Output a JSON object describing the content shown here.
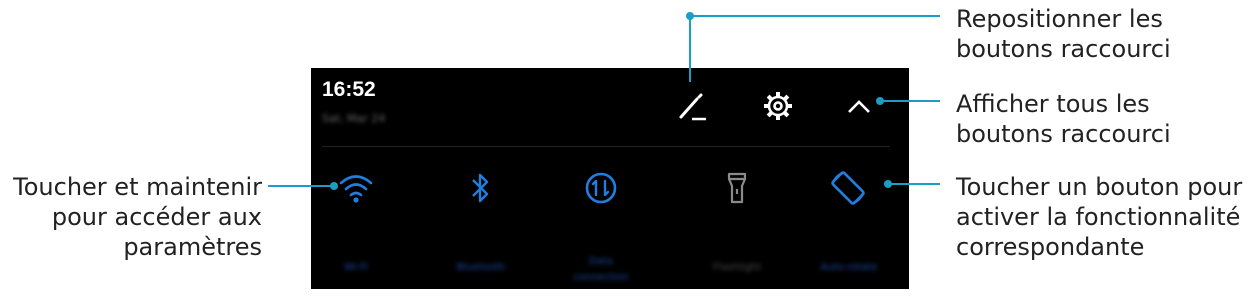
{
  "status": {
    "time": "16:52",
    "date": "Sat, Mar 24"
  },
  "toolbar": {
    "edit_icon": "pencil-edit-icon",
    "settings_icon": "gear-icon",
    "collapse_icon": "chevron-up-icon"
  },
  "tiles": [
    {
      "name": "wifi",
      "label": "Wi-Fi",
      "icon": "wifi-icon",
      "active": true
    },
    {
      "name": "bluetooth",
      "label": "Bluetooth",
      "icon": "bluetooth-icon",
      "active": true
    },
    {
      "name": "data",
      "label_line1": "Data",
      "label_line2": "connection",
      "icon": "mobile-data-icon",
      "active": true
    },
    {
      "name": "flashlight",
      "label": "Flashlight",
      "icon": "flashlight-icon",
      "active": false
    },
    {
      "name": "autorotate",
      "label": "Auto-rotate",
      "icon": "auto-rotate-icon",
      "active": true
    }
  ],
  "annotations": {
    "reorder_line1": "Repositionner les",
    "reorder_line2": "boutons raccourci",
    "showall_line1": "Afficher tous les",
    "showall_line2": "boutons raccourci",
    "tap_line1": "Toucher un bouton pour",
    "tap_line2": "activer la fonctionnalité",
    "tap_line3": "correspondante",
    "hold_line1": "Toucher et maintenir",
    "hold_line2": "pour accéder aux",
    "hold_line3": "paramètres"
  },
  "colors": {
    "panel_bg": "#000000",
    "accent": "#1f7fe0",
    "callout": "#1a9dc8",
    "inactive": "#8a8a8a"
  }
}
